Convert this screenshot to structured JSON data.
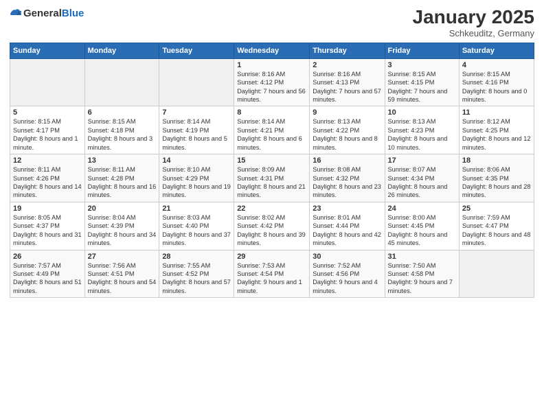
{
  "header": {
    "logo_general": "General",
    "logo_blue": "Blue",
    "month": "January 2025",
    "location": "Schkeuditz, Germany"
  },
  "weekdays": [
    "Sunday",
    "Monday",
    "Tuesday",
    "Wednesday",
    "Thursday",
    "Friday",
    "Saturday"
  ],
  "weeks": [
    [
      {
        "day": "",
        "info": ""
      },
      {
        "day": "",
        "info": ""
      },
      {
        "day": "",
        "info": ""
      },
      {
        "day": "1",
        "info": "Sunrise: 8:16 AM\nSunset: 4:12 PM\nDaylight: 7 hours\nand 56 minutes."
      },
      {
        "day": "2",
        "info": "Sunrise: 8:16 AM\nSunset: 4:13 PM\nDaylight: 7 hours\nand 57 minutes."
      },
      {
        "day": "3",
        "info": "Sunrise: 8:15 AM\nSunset: 4:15 PM\nDaylight: 7 hours\nand 59 minutes."
      },
      {
        "day": "4",
        "info": "Sunrise: 8:15 AM\nSunset: 4:16 PM\nDaylight: 8 hours\nand 0 minutes."
      }
    ],
    [
      {
        "day": "5",
        "info": "Sunrise: 8:15 AM\nSunset: 4:17 PM\nDaylight: 8 hours\nand 1 minute."
      },
      {
        "day": "6",
        "info": "Sunrise: 8:15 AM\nSunset: 4:18 PM\nDaylight: 8 hours\nand 3 minutes."
      },
      {
        "day": "7",
        "info": "Sunrise: 8:14 AM\nSunset: 4:19 PM\nDaylight: 8 hours\nand 5 minutes."
      },
      {
        "day": "8",
        "info": "Sunrise: 8:14 AM\nSunset: 4:21 PM\nDaylight: 8 hours\nand 6 minutes."
      },
      {
        "day": "9",
        "info": "Sunrise: 8:13 AM\nSunset: 4:22 PM\nDaylight: 8 hours\nand 8 minutes."
      },
      {
        "day": "10",
        "info": "Sunrise: 8:13 AM\nSunset: 4:23 PM\nDaylight: 8 hours\nand 10 minutes."
      },
      {
        "day": "11",
        "info": "Sunrise: 8:12 AM\nSunset: 4:25 PM\nDaylight: 8 hours\nand 12 minutes."
      }
    ],
    [
      {
        "day": "12",
        "info": "Sunrise: 8:11 AM\nSunset: 4:26 PM\nDaylight: 8 hours\nand 14 minutes."
      },
      {
        "day": "13",
        "info": "Sunrise: 8:11 AM\nSunset: 4:28 PM\nDaylight: 8 hours\nand 16 minutes."
      },
      {
        "day": "14",
        "info": "Sunrise: 8:10 AM\nSunset: 4:29 PM\nDaylight: 8 hours\nand 19 minutes."
      },
      {
        "day": "15",
        "info": "Sunrise: 8:09 AM\nSunset: 4:31 PM\nDaylight: 8 hours\nand 21 minutes."
      },
      {
        "day": "16",
        "info": "Sunrise: 8:08 AM\nSunset: 4:32 PM\nDaylight: 8 hours\nand 23 minutes."
      },
      {
        "day": "17",
        "info": "Sunrise: 8:07 AM\nSunset: 4:34 PM\nDaylight: 8 hours\nand 26 minutes."
      },
      {
        "day": "18",
        "info": "Sunrise: 8:06 AM\nSunset: 4:35 PM\nDaylight: 8 hours\nand 28 minutes."
      }
    ],
    [
      {
        "day": "19",
        "info": "Sunrise: 8:05 AM\nSunset: 4:37 PM\nDaylight: 8 hours\nand 31 minutes."
      },
      {
        "day": "20",
        "info": "Sunrise: 8:04 AM\nSunset: 4:39 PM\nDaylight: 8 hours\nand 34 minutes."
      },
      {
        "day": "21",
        "info": "Sunrise: 8:03 AM\nSunset: 4:40 PM\nDaylight: 8 hours\nand 37 minutes."
      },
      {
        "day": "22",
        "info": "Sunrise: 8:02 AM\nSunset: 4:42 PM\nDaylight: 8 hours\nand 39 minutes."
      },
      {
        "day": "23",
        "info": "Sunrise: 8:01 AM\nSunset: 4:44 PM\nDaylight: 8 hours\nand 42 minutes."
      },
      {
        "day": "24",
        "info": "Sunrise: 8:00 AM\nSunset: 4:45 PM\nDaylight: 8 hours\nand 45 minutes."
      },
      {
        "day": "25",
        "info": "Sunrise: 7:59 AM\nSunset: 4:47 PM\nDaylight: 8 hours\nand 48 minutes."
      }
    ],
    [
      {
        "day": "26",
        "info": "Sunrise: 7:57 AM\nSunset: 4:49 PM\nDaylight: 8 hours\nand 51 minutes."
      },
      {
        "day": "27",
        "info": "Sunrise: 7:56 AM\nSunset: 4:51 PM\nDaylight: 8 hours\nand 54 minutes."
      },
      {
        "day": "28",
        "info": "Sunrise: 7:55 AM\nSunset: 4:52 PM\nDaylight: 8 hours\nand 57 minutes."
      },
      {
        "day": "29",
        "info": "Sunrise: 7:53 AM\nSunset: 4:54 PM\nDaylight: 9 hours\nand 1 minute."
      },
      {
        "day": "30",
        "info": "Sunrise: 7:52 AM\nSunset: 4:56 PM\nDaylight: 9 hours\nand 4 minutes."
      },
      {
        "day": "31",
        "info": "Sunrise: 7:50 AM\nSunset: 4:58 PM\nDaylight: 9 hours\nand 7 minutes."
      },
      {
        "day": "",
        "info": ""
      }
    ]
  ]
}
